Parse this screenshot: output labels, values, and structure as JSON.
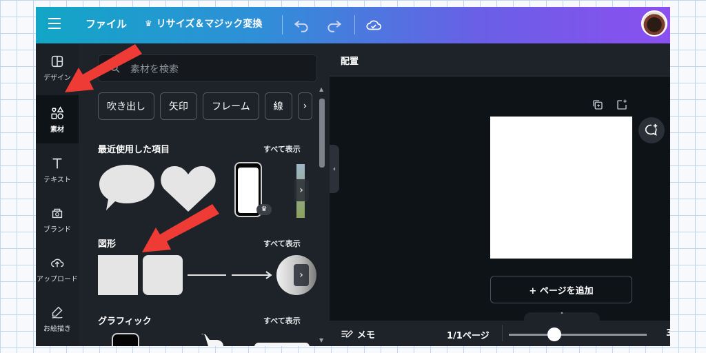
{
  "topbar": {
    "file_label": "ファイル",
    "resize_label": "リサイズ＆マジック変換"
  },
  "rail": {
    "items": [
      {
        "label": "デザイン"
      },
      {
        "label": "素材"
      },
      {
        "label": "テキスト"
      },
      {
        "label": "ブランド"
      },
      {
        "label": "アップロード"
      },
      {
        "label": "お絵描き"
      }
    ]
  },
  "panel": {
    "search_placeholder": "素材を検索",
    "chips": [
      "吹き出し",
      "矢印",
      "フレーム",
      "線"
    ],
    "sections": [
      {
        "title": "最近使用した項目",
        "see_all": "すべて表示"
      },
      {
        "title": "図形",
        "see_all": "すべて表示"
      },
      {
        "title": "グラフィック",
        "see_all": "すべて表示"
      }
    ]
  },
  "canvas": {
    "header_title": "配置",
    "add_page_label": "+ ページを追加"
  },
  "bottom": {
    "memo_label": "メモ",
    "page_count": "1/1ページ",
    "zoom_fragment": "3"
  },
  "colors": {
    "accent_start": "#12a6c6",
    "accent_end": "#8b4ff0",
    "annotation_arrow": "#ef3b36"
  }
}
